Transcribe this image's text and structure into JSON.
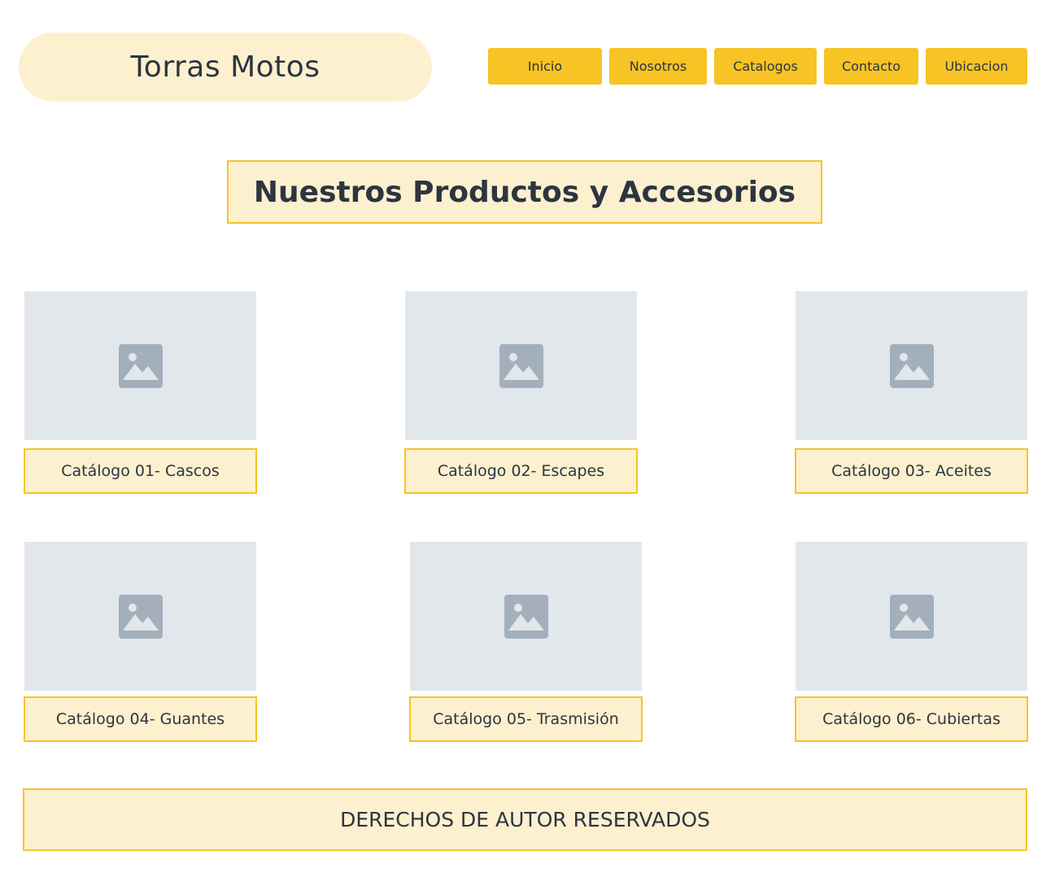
{
  "header": {
    "logo": "Torras Motos",
    "nav": [
      {
        "label": "Inicio"
      },
      {
        "label": "Nosotros"
      },
      {
        "label": "Catalogos"
      },
      {
        "label": "Contacto"
      },
      {
        "label": "Ubicacion"
      }
    ]
  },
  "main": {
    "title": "Nuestros Productos y Accesorios",
    "catalogs": [
      {
        "label": "Catálogo 01- Cascos",
        "icon": "image-placeholder-icon"
      },
      {
        "label": "Catálogo 02- Escapes",
        "icon": "image-placeholder-icon"
      },
      {
        "label": "Catálogo 03- Aceites",
        "icon": "image-placeholder-icon"
      },
      {
        "label": "Catálogo 04- Guantes",
        "icon": "image-placeholder-icon"
      },
      {
        "label": "Catálogo 05- Trasmisión",
        "icon": "image-placeholder-icon"
      },
      {
        "label": "Catálogo 06- Cubiertas",
        "icon": "image-placeholder-icon"
      }
    ]
  },
  "footer": {
    "text": "DERECHOS DE AUTOR RESERVADOS"
  },
  "colors": {
    "accent": "#f7c325",
    "light_accent": "#fdf0cf",
    "placeholder_bg": "#e2e7ec",
    "placeholder_icon": "#a3b0bc",
    "text": "#2c3540"
  }
}
